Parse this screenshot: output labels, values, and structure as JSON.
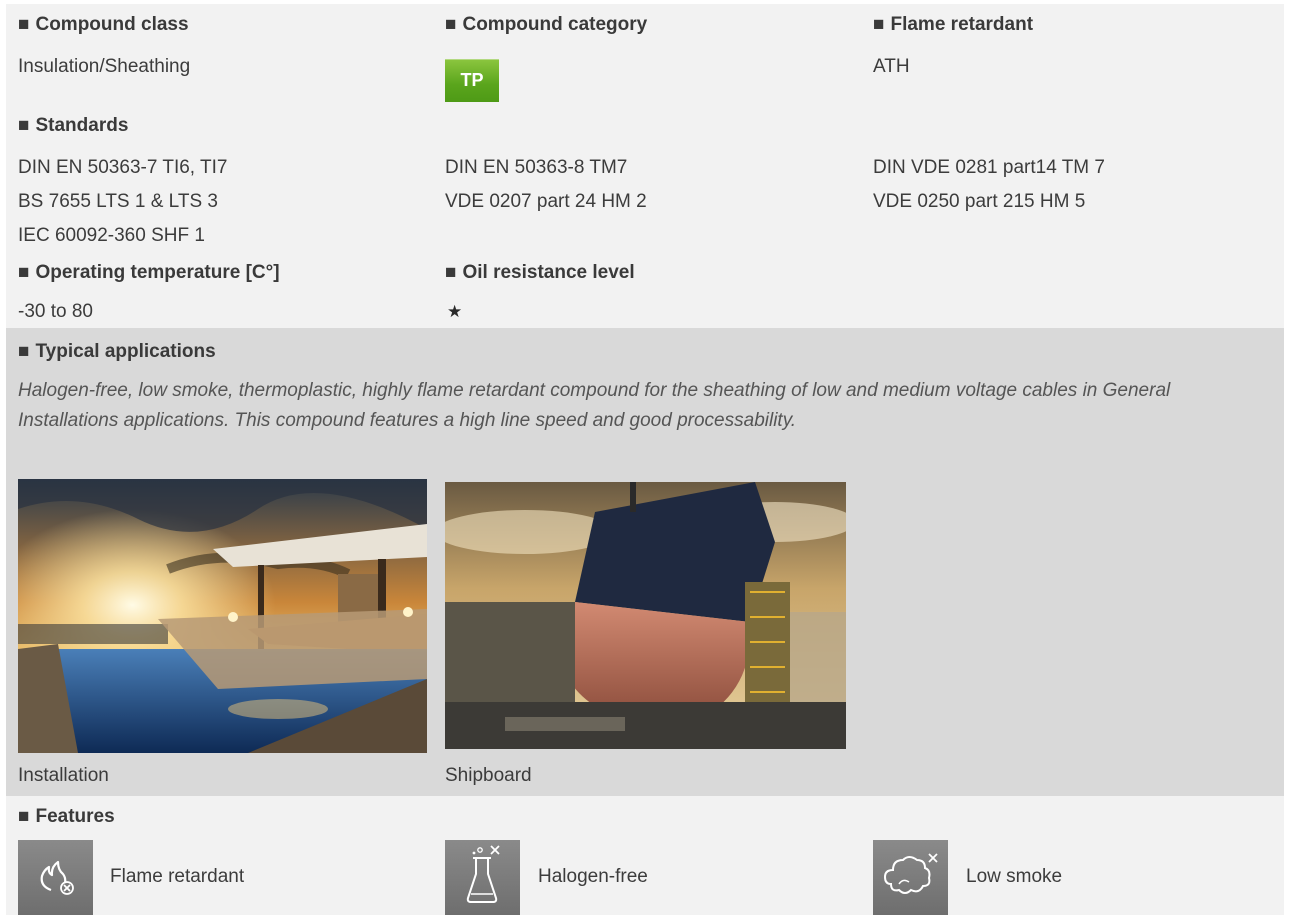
{
  "compound_class": {
    "heading": "Compound class",
    "value": "Insulation/Sheathing"
  },
  "compound_category": {
    "heading": "Compound category",
    "badge": "TP",
    "badge_color": "#6db33f"
  },
  "flame_retardant": {
    "heading": "Flame retardant",
    "value": "ATH"
  },
  "standards": {
    "heading": "Standards",
    "columns": [
      [
        "DIN EN 50363-7 TI6, TI7",
        "BS 7655 LTS 1 & LTS 3",
        "IEC 60092-360 SHF 1"
      ],
      [
        "DIN EN 50363-8 TM7",
        "VDE 0207 part 24 HM 2"
      ],
      [
        "DIN VDE 0281 part14 TM 7",
        "VDE 0250 part 215 HM 5"
      ]
    ]
  },
  "operating_temperature": {
    "heading": "Operating temperature [C°]",
    "value": "-30 to 80"
  },
  "oil_resistance": {
    "heading": "Oil resistance level",
    "value": "★",
    "stars": 1
  },
  "typical_applications": {
    "heading": "Typical applications",
    "description": "Halogen-free, low smoke, thermoplastic, highly flame retardant compound for the sheathing of low and medium voltage cables in General Installations applications. This compound features a high line speed and good processability.",
    "images": [
      {
        "caption": "Installation",
        "icon": "installation-photo"
      },
      {
        "caption": "Shipboard",
        "icon": "shipboard-photo"
      }
    ]
  },
  "features": {
    "heading": "Features",
    "items": [
      {
        "label": "Flame retardant",
        "icon": "flame-retardant-icon"
      },
      {
        "label": "Halogen-free",
        "icon": "halogen-free-icon"
      },
      {
        "label": "Low smoke",
        "icon": "low-smoke-icon"
      }
    ]
  },
  "colors": {
    "section_background": "#f2f2f2",
    "applications_background": "#d9d9d9",
    "feature_icon_background": "#7a7a7a"
  },
  "bullet": "■"
}
